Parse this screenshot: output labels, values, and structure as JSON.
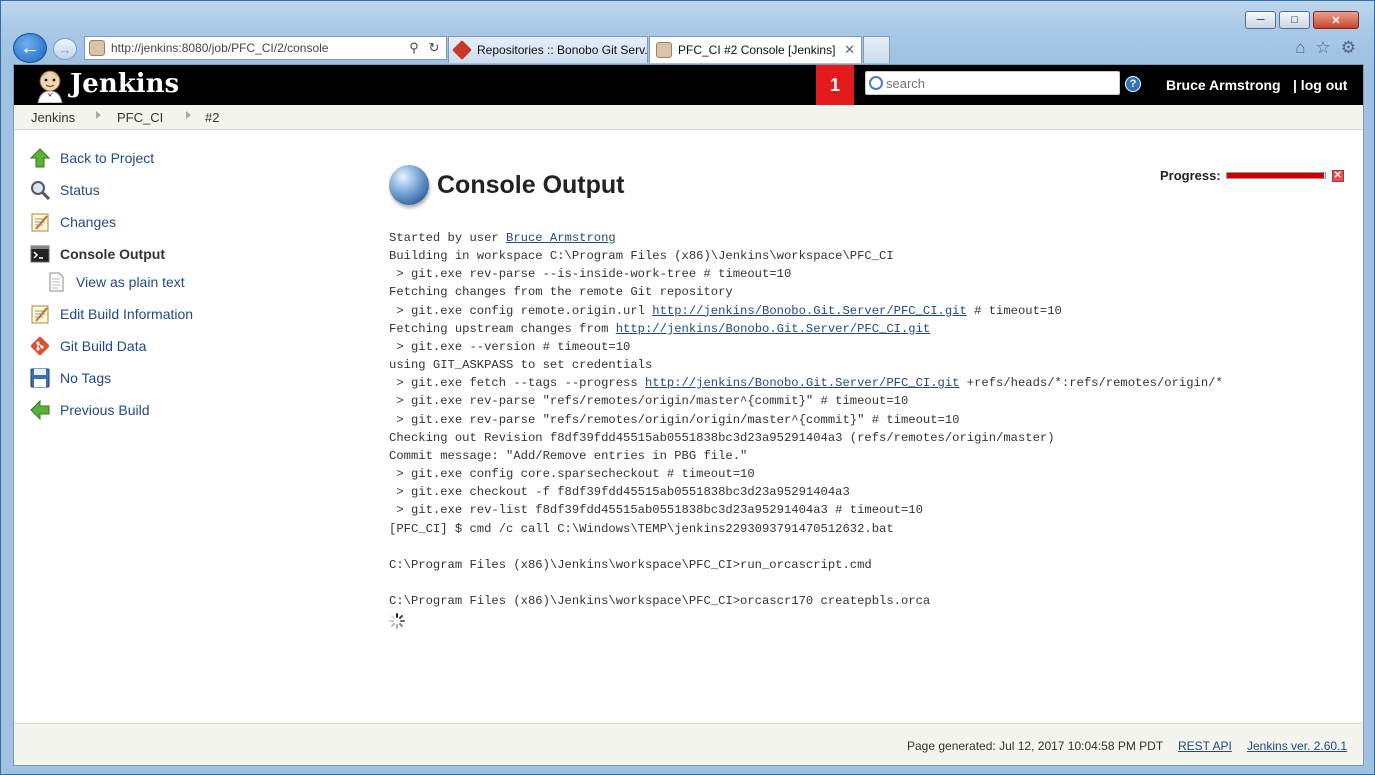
{
  "browser": {
    "address": "http://jenkins:8080/job/PFC_CI/2/console",
    "tabs": [
      {
        "label": "Repositories :: Bonobo Git Serv..."
      },
      {
        "label": "PFC_CI #2 Console [Jenkins]"
      }
    ]
  },
  "header": {
    "title": "Jenkins",
    "notifications": "1",
    "search_placeholder": "search",
    "user": "Bruce Armstrong",
    "logout": "| log out"
  },
  "breadcrumb": [
    "Jenkins",
    "PFC_CI",
    "#2"
  ],
  "sidebar": {
    "items": [
      {
        "label": "Back to Project",
        "icon": "up-arrow-icon"
      },
      {
        "label": "Status",
        "icon": "magnifier-icon"
      },
      {
        "label": "Changes",
        "icon": "notepad-icon"
      },
      {
        "label": "Console Output",
        "icon": "terminal-icon"
      },
      {
        "label": "View as plain text",
        "icon": "document-icon"
      },
      {
        "label": "Edit Build Information",
        "icon": "notepad-icon"
      },
      {
        "label": "Git Build Data",
        "icon": "git-icon"
      },
      {
        "label": "No Tags",
        "icon": "floppy-disk-icon"
      },
      {
        "label": "Previous Build",
        "icon": "left-arrow-icon"
      }
    ]
  },
  "main": {
    "title": "Console Output",
    "progress_label": "Progress:",
    "progress_value": 0.99
  },
  "console": {
    "started_by_prefix": "Started by user ",
    "started_by_user": "Bruce Armstrong",
    "line2": "Building in workspace C:\\Program Files (x86)\\Jenkins\\workspace\\PFC_CI",
    "line3": " > git.exe rev-parse --is-inside-work-tree # timeout=10",
    "line4": "Fetching changes from the remote Git repository",
    "line5_prefix": " > git.exe config remote.origin.url ",
    "repo_url": "http://jenkins/Bonobo.Git.Server/PFC_CI.git",
    "line5_suffix": " # timeout=10",
    "line6_prefix": "Fetching upstream changes from ",
    "line7": " > git.exe --version # timeout=10",
    "line8": "using GIT_ASKPASS to set credentials",
    "line9_prefix": " > git.exe fetch --tags --progress ",
    "line9_suffix": " +refs/heads/*:refs/remotes/origin/*",
    "line10": " > git.exe rev-parse \"refs/remotes/origin/master^{commit}\" # timeout=10",
    "line11": " > git.exe rev-parse \"refs/remotes/origin/origin/master^{commit}\" # timeout=10",
    "line12": "Checking out Revision f8df39fdd45515ab0551838bc3d23a95291404a3 (refs/remotes/origin/master)",
    "line13": "Commit message: \"Add/Remove entries in PBG file.\"",
    "line14": " > git.exe config core.sparsecheckout # timeout=10",
    "line15": " > git.exe checkout -f f8df39fdd45515ab0551838bc3d23a95291404a3",
    "line16": " > git.exe rev-list f8df39fdd45515ab0551838bc3d23a95291404a3 # timeout=10",
    "line17": "[PFC_CI] $ cmd /c call C:\\Windows\\TEMP\\jenkins2293093791470512632.bat",
    "line18": "",
    "line19": "C:\\Program Files (x86)\\Jenkins\\workspace\\PFC_CI>run_orcascript.cmd",
    "line20": "",
    "line21": "C:\\Program Files (x86)\\Jenkins\\workspace\\PFC_CI>orcascr170 createpbls.orca"
  },
  "footer": {
    "generated": "Page generated: Jul 12, 2017 10:04:58 PM PDT",
    "rest_api": "REST API",
    "version": "Jenkins ver. 2.60.1"
  },
  "colors": {
    "header_bg": "#000000",
    "notification_bg": "#e31a1c",
    "link": "#204a87",
    "progress": "#cc0000"
  }
}
